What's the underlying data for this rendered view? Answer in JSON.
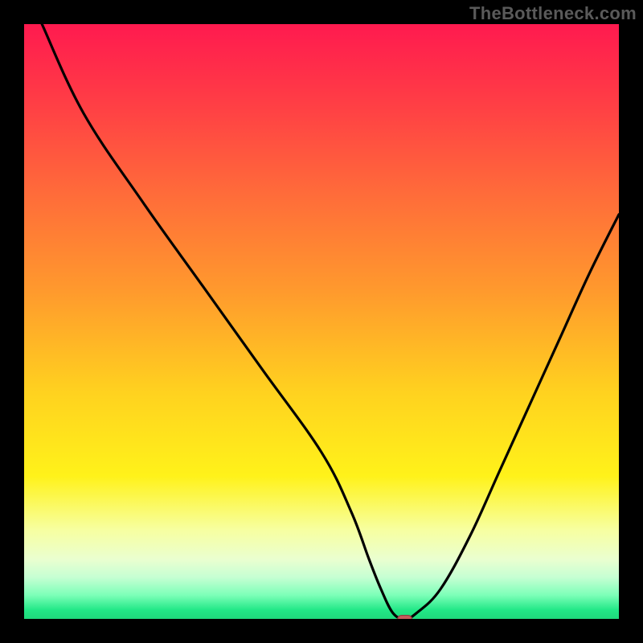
{
  "watermark": "TheBottleneck.com",
  "colors": {
    "frame": "#000000",
    "watermark_text": "#5a5a5a",
    "line": "#000000",
    "marker_fill": "#c65a5c",
    "marker_stroke": "#8a3e40",
    "gradient_stops": [
      {
        "offset": 0.0,
        "color": "#ff1a4f"
      },
      {
        "offset": 0.12,
        "color": "#ff3a46"
      },
      {
        "offset": 0.28,
        "color": "#ff6a3a"
      },
      {
        "offset": 0.45,
        "color": "#ff9a2d"
      },
      {
        "offset": 0.62,
        "color": "#ffd21f"
      },
      {
        "offset": 0.76,
        "color": "#fff21a"
      },
      {
        "offset": 0.85,
        "color": "#f7ffa0"
      },
      {
        "offset": 0.9,
        "color": "#eaffd0"
      },
      {
        "offset": 0.93,
        "color": "#c6ffd3"
      },
      {
        "offset": 0.96,
        "color": "#7dffb8"
      },
      {
        "offset": 0.985,
        "color": "#22e887"
      },
      {
        "offset": 1.0,
        "color": "#1fd87c"
      }
    ]
  },
  "chart_data": {
    "type": "line",
    "title": "",
    "xlabel": "",
    "ylabel": "",
    "xlim": [
      0,
      100
    ],
    "ylim": [
      0,
      100
    ],
    "legend": false,
    "grid": false,
    "series": [
      {
        "name": "bottleneck-curve",
        "x": [
          3,
          10,
          20,
          30,
          40,
          50,
          55,
          58,
          60,
          62,
          64,
          66,
          70,
          75,
          80,
          85,
          90,
          95,
          100
        ],
        "y": [
          100,
          85,
          70,
          56,
          42,
          28,
          18,
          10,
          5,
          1,
          0,
          1,
          5,
          14,
          25,
          36,
          47,
          58,
          68
        ]
      }
    ],
    "annotations": [
      {
        "name": "minimum-marker",
        "shape": "rounded-rect",
        "x": 64,
        "y": 0,
        "width_pct": 2.4,
        "height_pct": 1.2
      }
    ]
  }
}
